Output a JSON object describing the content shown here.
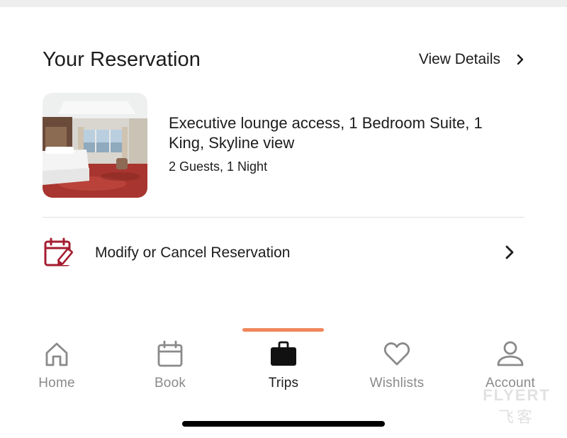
{
  "reservation": {
    "title": "Your Reservation",
    "view_details_label": "View Details",
    "room_name": "Executive lounge access, 1 Bedroom Suite, 1 King, Skyline view",
    "room_meta": "2 Guests, 1 Night"
  },
  "modify": {
    "label": "Modify or Cancel Reservation",
    "icon": "calendar-edit-icon"
  },
  "tabbar": {
    "active": "Trips",
    "tabs": [
      {
        "label": "Home",
        "icon": "home-icon"
      },
      {
        "label": "Book",
        "icon": "calendar-icon"
      },
      {
        "label": "Trips",
        "icon": "briefcase-icon"
      },
      {
        "label": "Wishlists",
        "icon": "heart-icon"
      },
      {
        "label": "Account",
        "icon": "person-icon"
      }
    ]
  },
  "watermark": {
    "line1": "FLYERT",
    "line2": "飞客"
  },
  "colors": {
    "accent": "#f0865b",
    "brand_icon": "#a51c30",
    "inactive": "#8a8a8a",
    "text": "#1c1c1c"
  }
}
